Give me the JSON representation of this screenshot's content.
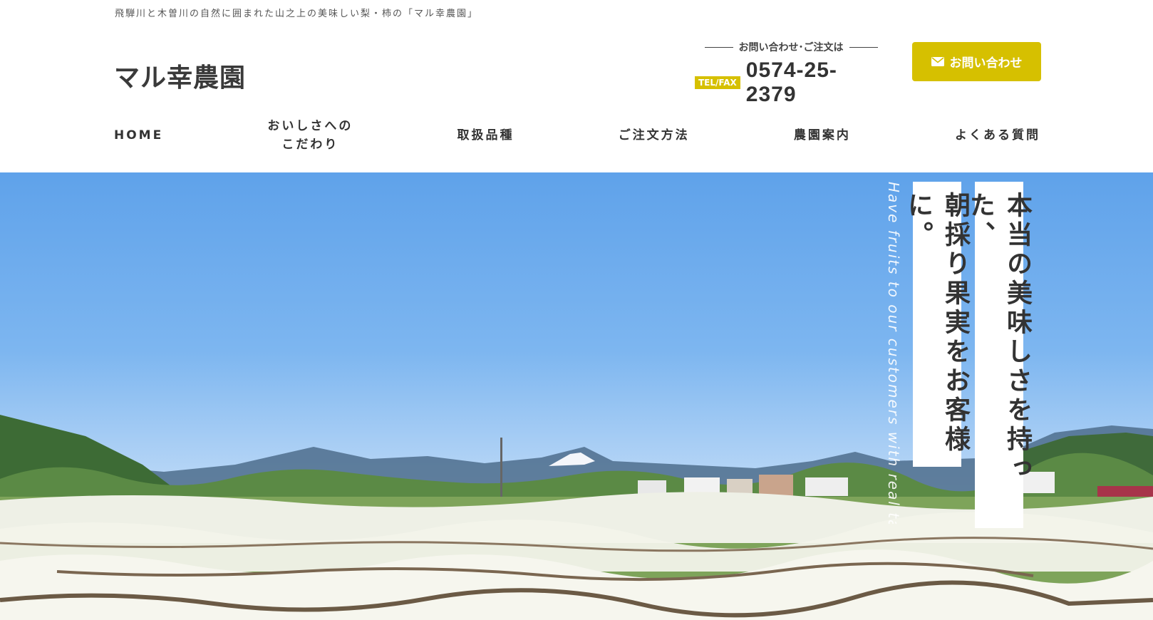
{
  "header": {
    "tagline": "飛騨川と木曽川の自然に囲まれた山之上の美味しい梨・柿の「マル幸農園」",
    "logo": "マル幸農園",
    "contact_lead": "お問い合わせ･ご注文は",
    "tel_badge": "TEL/FAX",
    "phone": "0574-25-2379",
    "contact_button": "お問い合わせ"
  },
  "nav": {
    "items": [
      {
        "label": "HOME"
      },
      {
        "label_line1": "おいしさへの",
        "label_line2": "こだわり"
      },
      {
        "label": "取扱品種"
      },
      {
        "label": "ご注文方法"
      },
      {
        "label": "農園案内"
      },
      {
        "label": "よくある質問"
      }
    ]
  },
  "hero": {
    "vertical_english": "Have fruits to our customers with real taste.",
    "copy_line1": "本当の美味しさを持った、",
    "copy_line2": "朝採り果実をお客様に。"
  },
  "colors": {
    "accent": "#d6c000",
    "text": "#333333",
    "sky_top": "#5fa2ea"
  },
  "icons": {
    "mail": "mail-icon"
  }
}
